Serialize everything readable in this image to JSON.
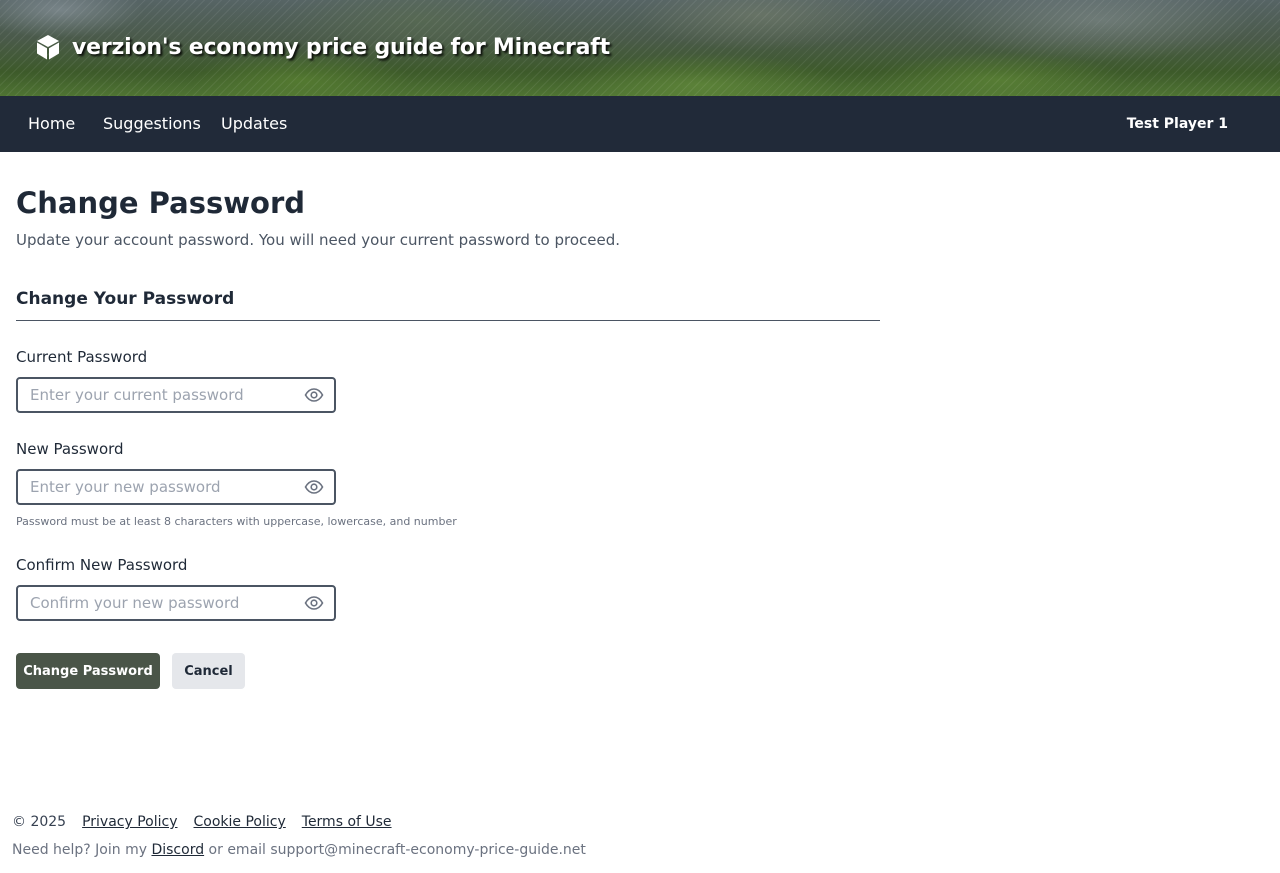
{
  "banner": {
    "title": "verzion's economy price guide for Minecraft",
    "icon": "cube-icon"
  },
  "nav": {
    "links": [
      {
        "label": "Home"
      },
      {
        "label": "Suggestions"
      },
      {
        "label": "Updates"
      }
    ],
    "user": "Test Player 1"
  },
  "main": {
    "title": "Change Password",
    "subtitle": "Update your account password. You will need your current password to proceed.",
    "section_title": "Change Your Password",
    "fields": [
      {
        "label": "Current Password",
        "placeholder": "Enter your current password",
        "value": "",
        "icon": "eye-icon"
      },
      {
        "label": "New Password",
        "placeholder": "Enter your new password",
        "value": "",
        "icon": "eye-icon"
      },
      {
        "label": "Confirm New Password",
        "placeholder": "Confirm your new password",
        "value": "",
        "icon": "eye-icon"
      }
    ],
    "hint": "Password must be at least 8 characters with uppercase, lowercase, and number",
    "submit_label": "Change Password",
    "cancel_label": "Cancel"
  },
  "footer": {
    "copyright": "© 2025",
    "links": [
      "Privacy Policy",
      "Cookie Policy",
      "Terms of Use"
    ],
    "help_prefix": "Need help? Join my",
    "discord_label": "Discord",
    "help_suffix": "or email support@minecraft-economy-price-guide.net"
  },
  "colors": {
    "nav_bg": "#212a39",
    "primary_button": "#4a5548",
    "secondary_button": "#e5e7eb"
  }
}
